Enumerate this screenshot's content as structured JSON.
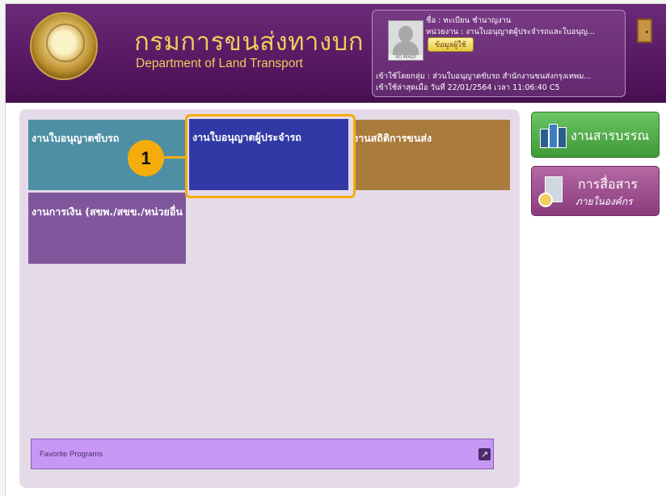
{
  "header": {
    "logo_th": "กรมการขนส่งทางบก",
    "logo_en": "Department of Land Transport"
  },
  "user": {
    "name": "ชื่อ : ทะเบียน ชำนาญงาน",
    "unit": "หน่วยงาน : งานใบอนุญาตผู้ประจำรถและใบอนุญ...",
    "info_button": "ข้อมูลผู้ใช้",
    "group": "เข้าใช้โดยกลุ่ม : ส่วนใบอนุญาตขับรถ สำนักงานขนส่งกรุงเทพม...",
    "last_login": "เข้าใช้ล่าสุดเมื่อ วันที่ 22/01/2564 เวลา 11:06:40 C5",
    "avatar_caption": "NO IMAGE"
  },
  "tiles": [
    {
      "label": "งานใบอนุญาตขับรถ",
      "color": "#4e8fa4"
    },
    {
      "label": "งานใบอนุญาตผู้ประจำรถ",
      "color": "#3039a5"
    },
    {
      "label": "งานสถิติการขนส่ง",
      "color": "#a97b3c"
    },
    {
      "label": "งานการเงิน (สขพ./สขข./หน่วยอื่น",
      "color": "#80579d"
    }
  ],
  "annotation": {
    "number": "1",
    "color": "#f5ad0b"
  },
  "favorites": {
    "label": "Favorite Programs"
  },
  "side": {
    "archive_label": "งานสารบรรณ",
    "comm_label": "การสื่อสาร",
    "comm_sub": "ภายในองค์กร"
  },
  "icons": [
    "seal-logo",
    "user-avatar",
    "exit-door-icon",
    "external-link-icon",
    "document-archive-icon",
    "building-cd-icon"
  ]
}
